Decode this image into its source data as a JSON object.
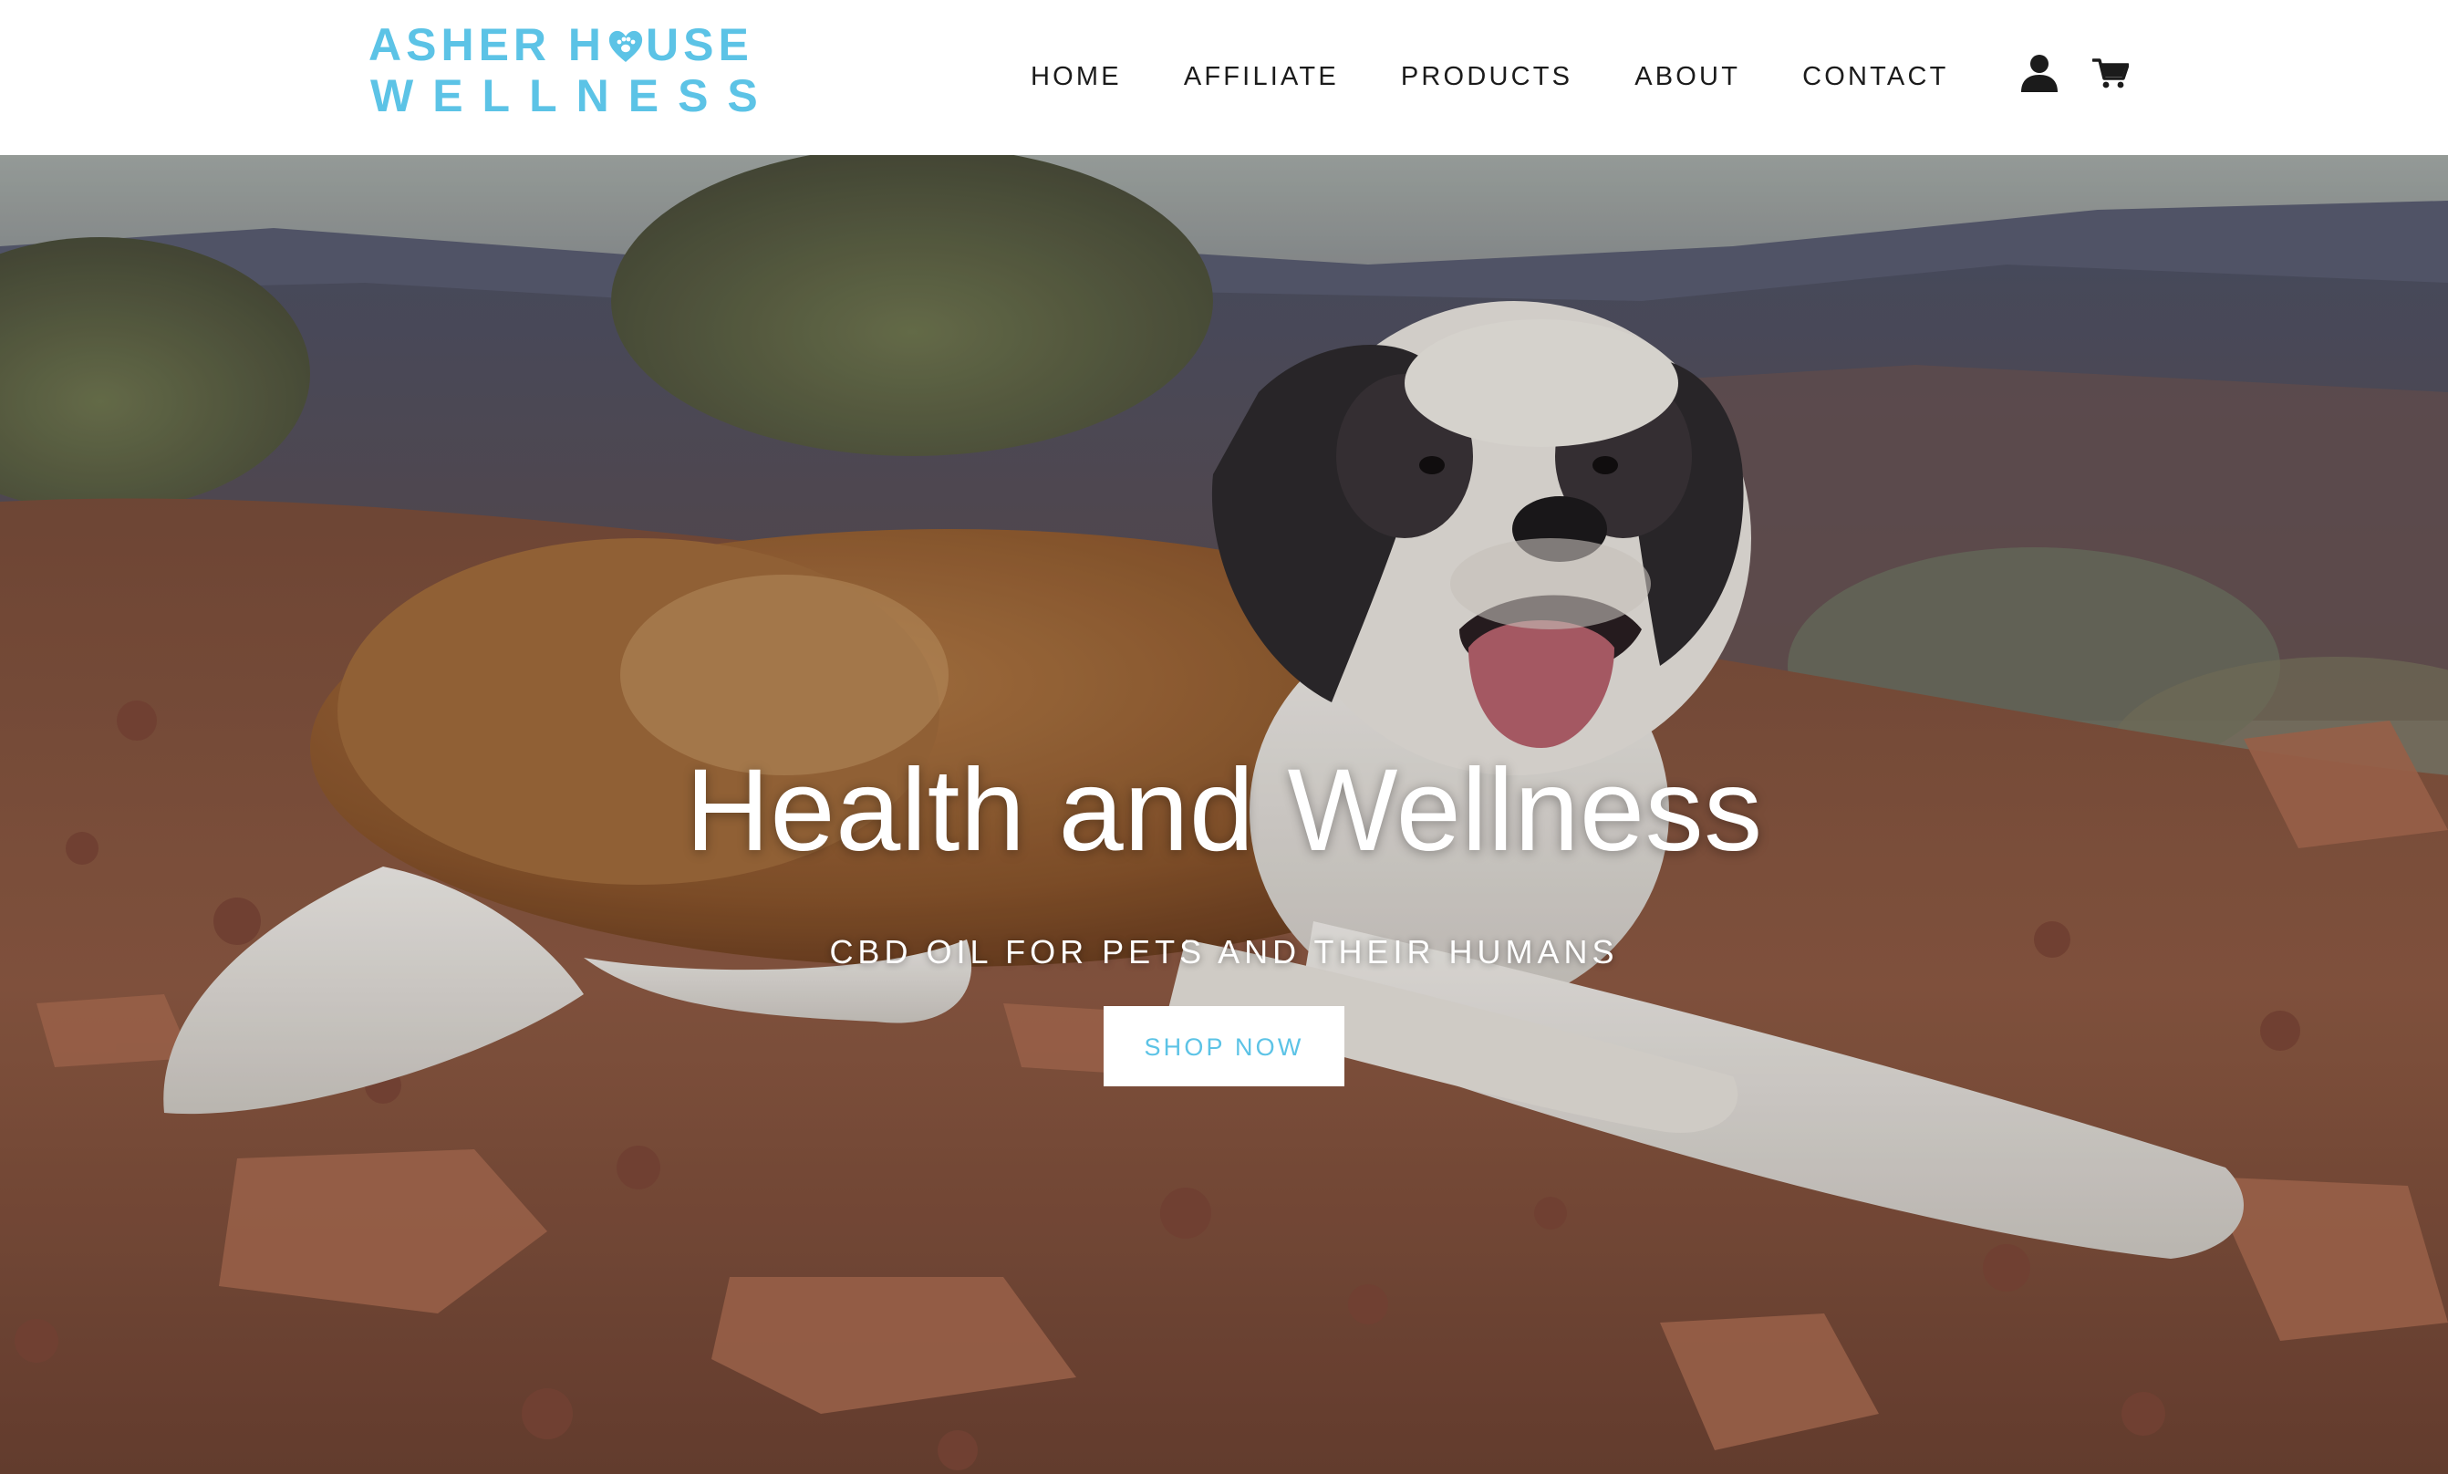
{
  "header": {
    "logo": {
      "line1_before": "ASHER H",
      "line1_after": "USE",
      "line2": "WELLNESS",
      "color": "#5cc3e6"
    },
    "nav": [
      {
        "label": "HOME"
      },
      {
        "label": "AFFILIATE"
      },
      {
        "label": "PRODUCTS"
      },
      {
        "label": "ABOUT"
      },
      {
        "label": "CONTACT"
      }
    ],
    "icons": {
      "account": "account-icon",
      "cart": "cart-icon"
    }
  },
  "hero": {
    "title": "Health and Wellness",
    "subtitle": "CBD OIL FOR PETS AND THEIR HUMANS",
    "button_label": "SHOP NOW",
    "image_subject": "st-bernard-dog-on-red-rocky-desert-hillside"
  },
  "colors": {
    "accent": "#5cc3e6",
    "nav_text": "#1b1b1b",
    "hero_text": "#ffffff"
  }
}
